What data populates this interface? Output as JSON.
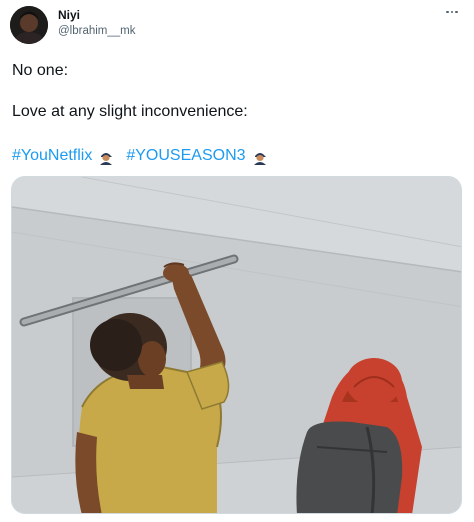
{
  "tweet": {
    "author": {
      "display_name": "Niyi",
      "handle": "@lbrahim__mk",
      "avatar_icon": "user-avatar-photo"
    },
    "more_icon": "more-options-icon",
    "text_lines": [
      "No one:",
      "Love at any slight inconvenience:"
    ],
    "hashtags": [
      {
        "text": "#YouNetflix",
        "emoji": "person-in-cap-emoji"
      },
      {
        "text": "#YOUSEASON3",
        "emoji": "person-in-cap-emoji"
      }
    ],
    "media": {
      "kind": "illustration",
      "icon": "meme-illustration-man-with-pipe-behind-hooded-person"
    },
    "colors": {
      "link": "#1d9bf0",
      "secondary_text": "#536471",
      "primary_text": "#0f1419",
      "border": "#cfd9de"
    }
  }
}
